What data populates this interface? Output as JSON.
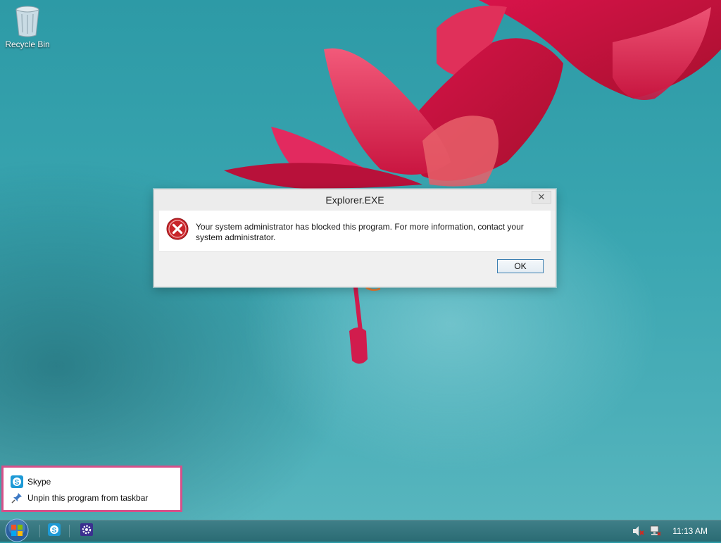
{
  "desktop": {
    "recycle_bin_label": "Recycle Bin"
  },
  "dialog": {
    "title": "Explorer.EXE",
    "close_glyph": "✕",
    "message": "Your system administrator has blocked this program. For more information, contact your system administrator.",
    "ok_label": "OK",
    "icon": "error-icon"
  },
  "jumplist": {
    "items": [
      {
        "label": "Skype",
        "icon": "skype-icon"
      },
      {
        "label": "Unpin this program from taskbar",
        "icon": "pin-icon"
      }
    ]
  },
  "taskbar": {
    "pinned": [
      "skype-icon",
      "settings-gear-icon"
    ],
    "tray": [
      "volume-muted-icon",
      "network-disconnected-icon"
    ],
    "clock": "11:13 AM"
  },
  "colors": {
    "highlight_border": "#d6508a",
    "ok_button_border": "#3c7fb1",
    "error_red": "#c8262b"
  }
}
